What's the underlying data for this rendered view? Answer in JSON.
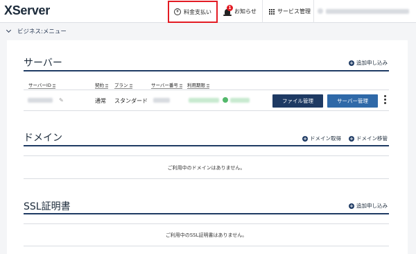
{
  "header": {
    "logo": "XServer",
    "nav": {
      "payment": "料金支払い",
      "payment_icon": "yen-icon",
      "news": "お知らせ",
      "news_badge": "1",
      "news_icon": "bell-icon",
      "service": "サービス管理",
      "service_icon": "grid-icon"
    },
    "highlight_color": "#e31b23"
  },
  "submenu": {
    "label": "ビジネス:メニュー"
  },
  "server_section": {
    "title": "サーバー",
    "add_link": "追加申し込み",
    "columns": [
      "サーバーID",
      "契約",
      "プラン",
      "サーバー番号",
      "利用期限"
    ],
    "rows": [
      {
        "contract": "通常",
        "plan": "スタンダード"
      }
    ],
    "file_button": "ファイル管理",
    "server_button": "サーバー管理"
  },
  "domain_section": {
    "title": "ドメイン",
    "acquire_link": "ドメイン取得",
    "transfer_link": "ドメイン移管",
    "empty_message": "ご利用中のドメインはありません。"
  },
  "ssl_section": {
    "title": "SSL証明書",
    "add_link": "追加申し込み",
    "empty_message": "ご利用中のSSL証明書はありません。"
  },
  "colors": {
    "navy": "#1e3a63",
    "button_blue": "#2f69a8"
  }
}
